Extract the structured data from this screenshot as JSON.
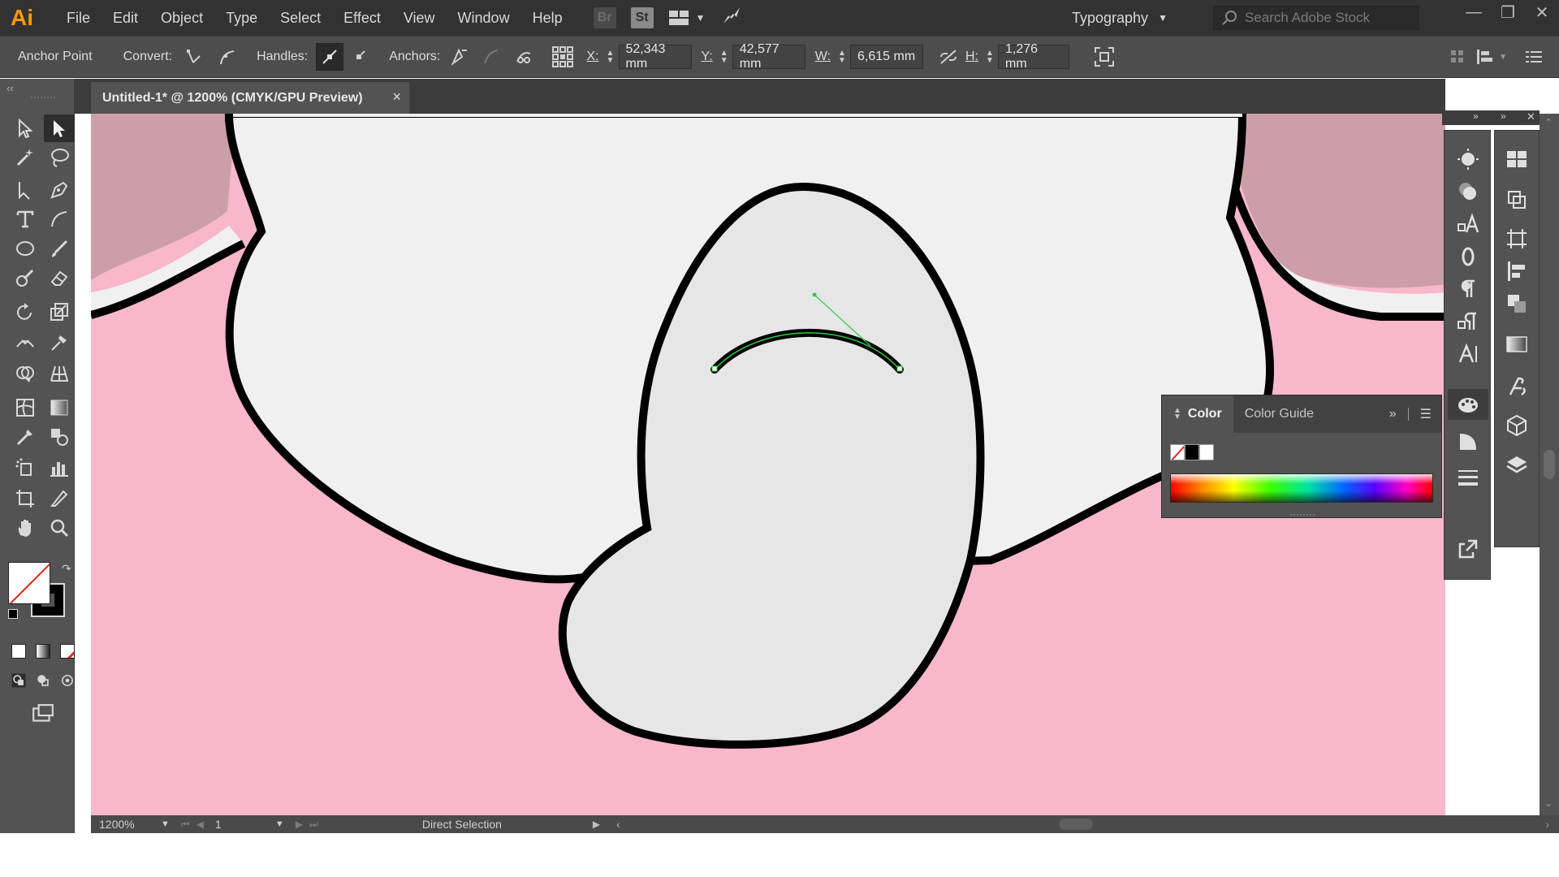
{
  "app": {
    "logo": "Ai",
    "menu": [
      "File",
      "Edit",
      "Object",
      "Type",
      "Select",
      "Effect",
      "View",
      "Window",
      "Help"
    ],
    "bridge_badge": "Br",
    "stock_badge": "St",
    "workspace": "Typography",
    "search_placeholder": "Search Adobe Stock"
  },
  "control_bar": {
    "selection": "Anchor Point",
    "convert_label": "Convert:",
    "handles_label": "Handles:",
    "anchors_label": "Anchors:",
    "x_label": "X:",
    "x_value": "52,343 mm",
    "y_label": "Y:",
    "y_value": "42,577 mm",
    "w_label": "W:",
    "w_value": "6,615 mm",
    "h_label": "H:",
    "h_value": "1,276 mm"
  },
  "document": {
    "tab_title": "Untitled-1* @ 1200% (CMYK/GPU Preview)",
    "close_glyph": "×"
  },
  "color_panel": {
    "tab_active": "Color",
    "tab_other": "Color Guide"
  },
  "status_bar": {
    "zoom": "1200%",
    "page": "1",
    "mode": "Direct Selection"
  },
  "colors": {
    "canvas_background": "#f8b7cb",
    "shape_fill": "#f0f0f0",
    "nose_fill": "#e6e6e6",
    "ear_fill": "#cc9fa8",
    "selected_path": "#2ecc40",
    "app_accent": "#ff9a00"
  }
}
